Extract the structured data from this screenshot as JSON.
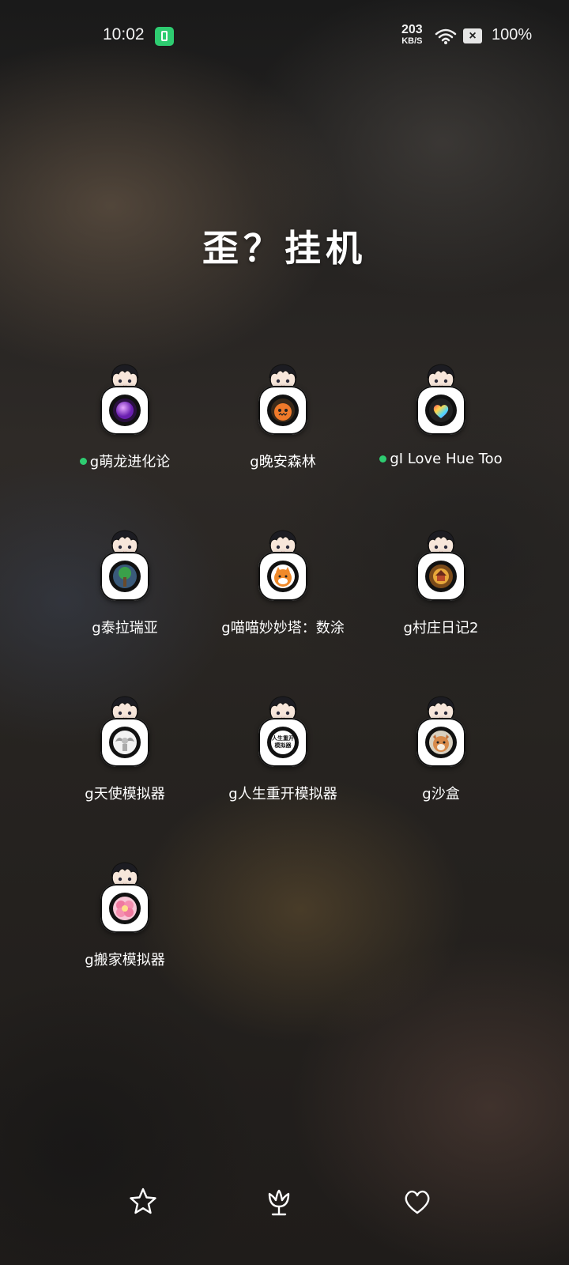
{
  "status": {
    "time": "10:02",
    "net_speed": "203",
    "net_unit": "KB/S",
    "battery": "100%",
    "sim_mark": "×",
    "icons": [
      "battery-saver-icon",
      "wifi-icon",
      "no-sim-icon"
    ]
  },
  "title": "歪？挂机",
  "apps": [
    {
      "label": "g萌龙进化论",
      "dot": true,
      "art": "purple-sphere"
    },
    {
      "label": "g晚安森林",
      "dot": false,
      "art": "orange-creature"
    },
    {
      "label": "gI Love Hue Too",
      "dot": true,
      "art": "rainbow-heart"
    },
    {
      "label": "g泰拉瑞亚",
      "dot": false,
      "art": "tree"
    },
    {
      "label": "g喵喵妙妙塔：数涂",
      "dot": false,
      "art": "orange-cat"
    },
    {
      "label": "g村庄日记2",
      "dot": false,
      "art": "village"
    },
    {
      "label": "g天使模拟器",
      "dot": false,
      "art": "angel"
    },
    {
      "label": "g人生重开模拟器",
      "dot": false,
      "art": "text-badge",
      "art_text": "人生重开模拟器"
    },
    {
      "label": "g沙盒",
      "dot": false,
      "art": "fox"
    },
    {
      "label": "g搬家模拟器",
      "dot": false,
      "art": "pink-flower"
    }
  ],
  "dock": [
    "star-icon",
    "flower-icon",
    "heart-icon"
  ],
  "colors": {
    "accent_green": "#2ecc71",
    "badge_bg": "#ffffff"
  }
}
